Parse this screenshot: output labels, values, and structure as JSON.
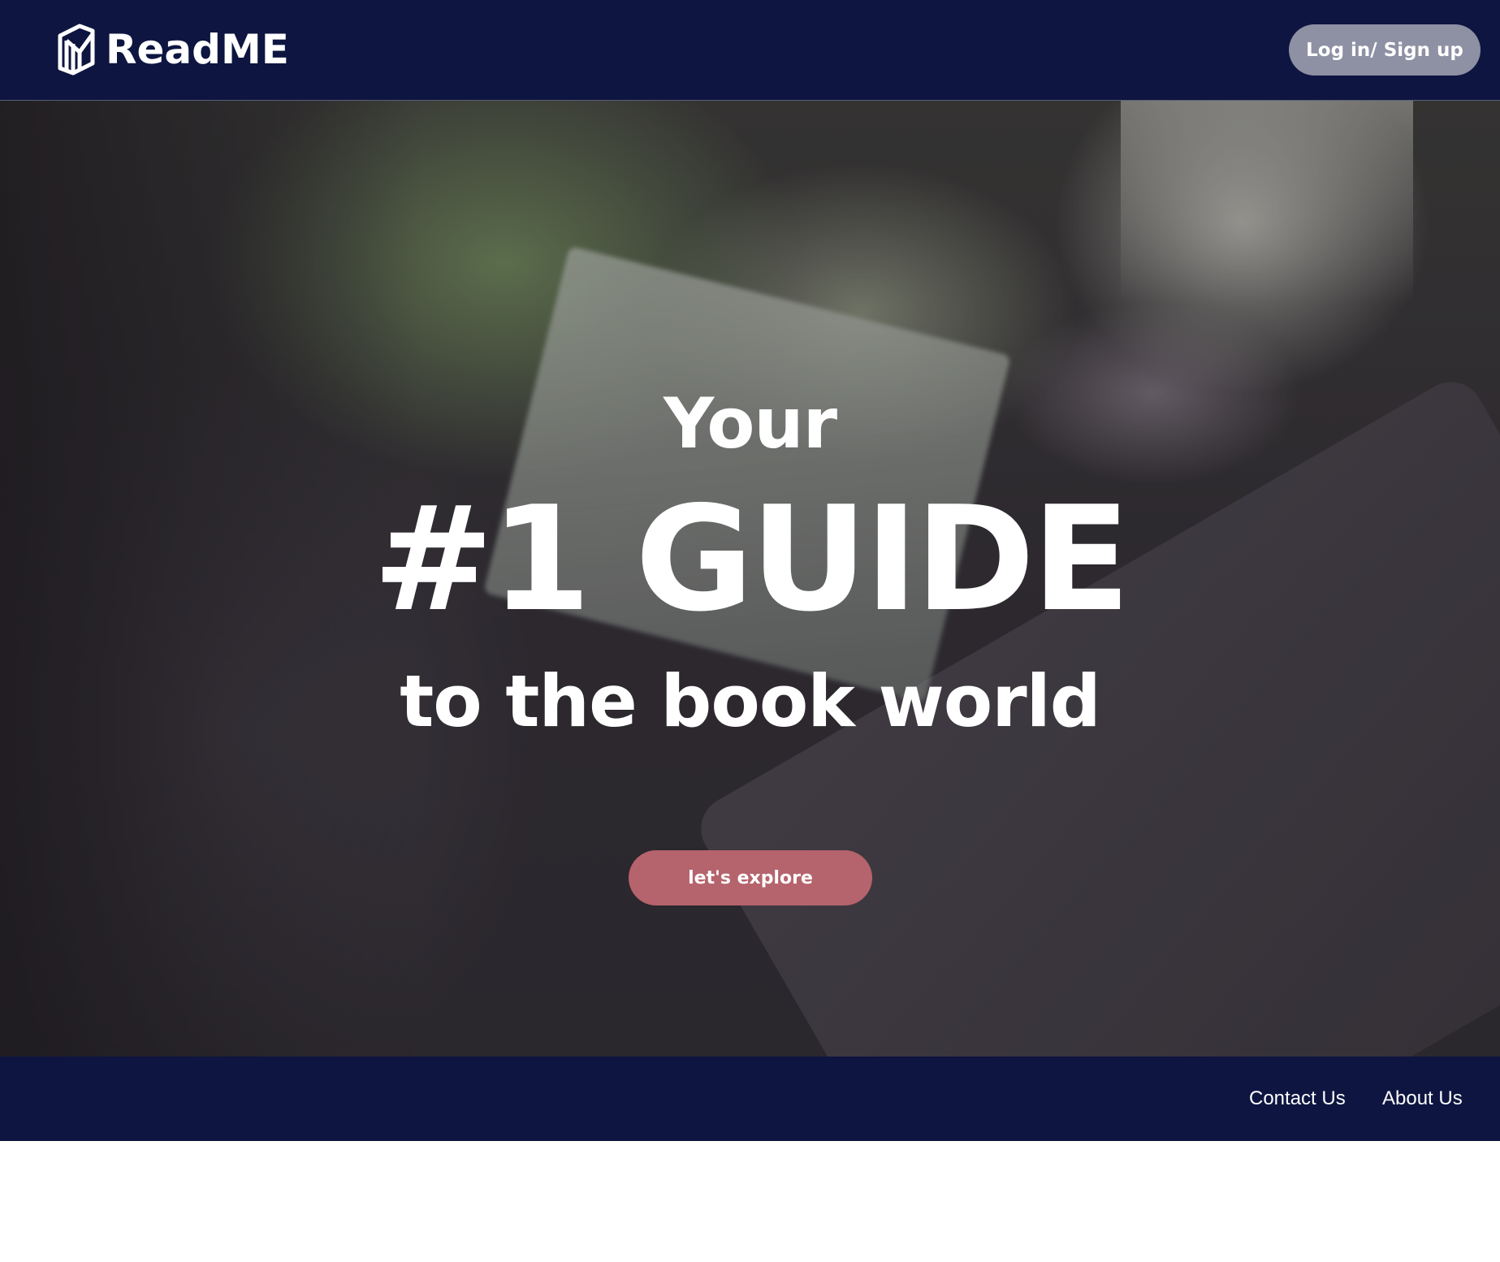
{
  "header": {
    "brand": "ReadME",
    "brand_icon": "book-logo-icon",
    "login_label": "Log in/ Sign up",
    "background_color": "#0d1540"
  },
  "hero": {
    "line1": "Your",
    "line2": "#1 GUIDE",
    "line3": "to the book world",
    "cta_label": "let's explore",
    "cta_color": "#b5636c"
  },
  "footer": {
    "links": [
      {
        "label": "Contact Us"
      },
      {
        "label": "About Us"
      }
    ],
    "background_color": "#0d1540"
  }
}
